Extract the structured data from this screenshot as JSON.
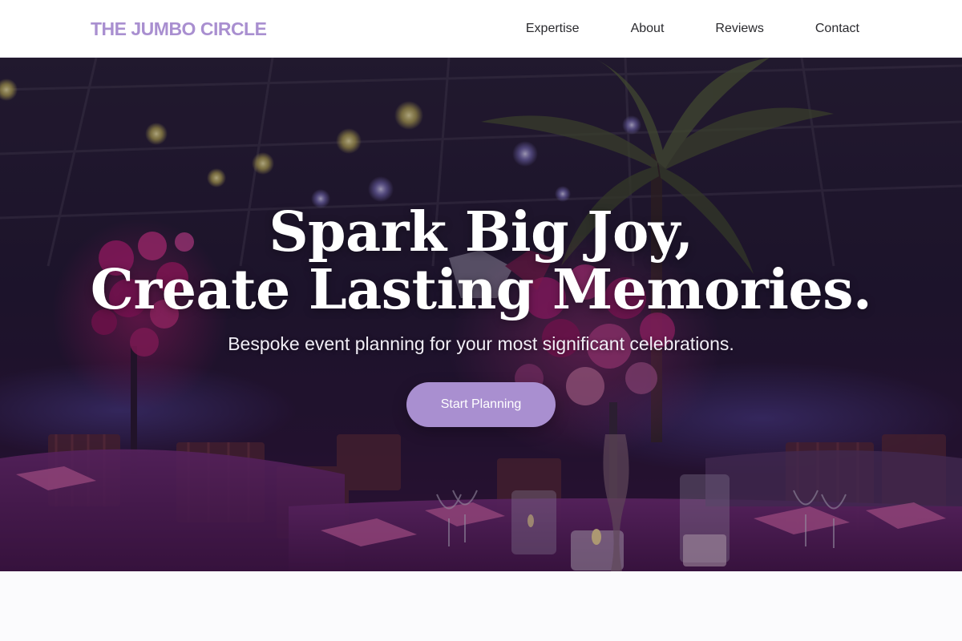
{
  "brand": {
    "name": "THE JUMBO CIRCLE",
    "accent_color": "#a98fd0"
  },
  "nav": {
    "items": [
      {
        "label": "Expertise"
      },
      {
        "label": "About"
      },
      {
        "label": "Reviews"
      },
      {
        "label": "Contact"
      }
    ]
  },
  "hero": {
    "headline_line1": "Spark Big Joy,",
    "headline_line2": "Create Lasting Memories.",
    "subheadline": "Bespoke event planning for your most significant celebrations.",
    "cta_label": "Start Planning",
    "background_image": "event-venue-photo"
  }
}
